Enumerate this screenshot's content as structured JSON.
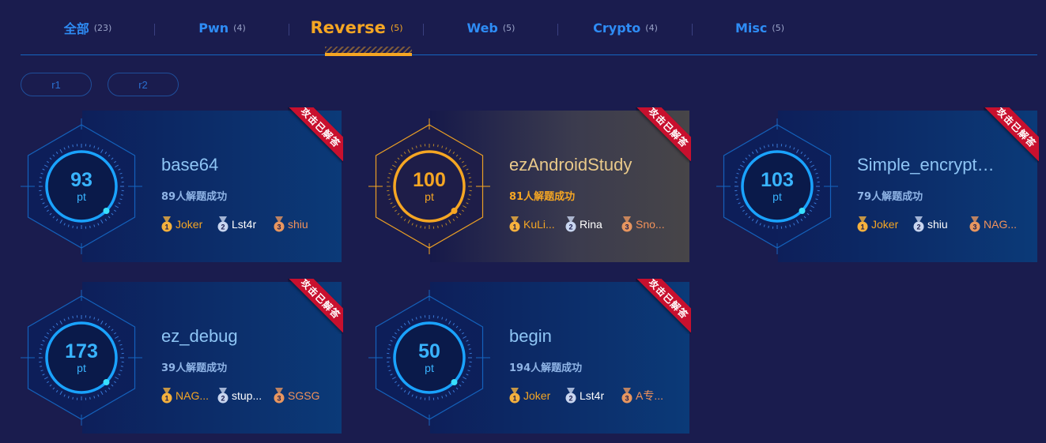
{
  "tabs": [
    {
      "label": "全部",
      "count": "(23)"
    },
    {
      "label": "Pwn",
      "count": "(4)"
    },
    {
      "label": "Reverse",
      "count": "(5)"
    },
    {
      "label": "Web",
      "count": "(5)"
    },
    {
      "label": "Crypto",
      "count": "(4)"
    },
    {
      "label": "Misc",
      "count": "(5)"
    }
  ],
  "active_tab": "Reverse",
  "filters": [
    "r1",
    "r2"
  ],
  "colors": {
    "accent": "#f5a623",
    "primary": "#2e8cf5",
    "ribbon": "#c8102e",
    "background": "#1a1c4e"
  },
  "ribbon_text": "攻击已解答",
  "cards": [
    {
      "score": "93",
      "unit": "pt",
      "name": "base64",
      "solved": "89人解题成功",
      "solvers": [
        {
          "rank": "1",
          "name": "Joker"
        },
        {
          "rank": "2",
          "name": "Lst4r"
        },
        {
          "rank": "3",
          "name": "shiu"
        }
      ]
    },
    {
      "score": "100",
      "unit": "pt",
      "name": "ezAndroidStudy",
      "solved": "81人解题成功",
      "highlighted": true,
      "solvers": [
        {
          "rank": "1",
          "name": "KuLi..."
        },
        {
          "rank": "2",
          "name": "Rina"
        },
        {
          "rank": "3",
          "name": "Sno..."
        }
      ]
    },
    {
      "score": "103",
      "unit": "pt",
      "name": "Simple_encrypt…",
      "solved": "79人解题成功",
      "solvers": [
        {
          "rank": "1",
          "name": "Joker"
        },
        {
          "rank": "2",
          "name": "shiu"
        },
        {
          "rank": "3",
          "name": "NAG..."
        }
      ]
    },
    {
      "score": "173",
      "unit": "pt",
      "name": "ez_debug",
      "solved": "39人解题成功",
      "solvers": [
        {
          "rank": "1",
          "name": "NAG..."
        },
        {
          "rank": "2",
          "name": "stup..."
        },
        {
          "rank": "3",
          "name": "SGSG"
        }
      ]
    },
    {
      "score": "50",
      "unit": "pt",
      "name": "begin",
      "solved": "194人解题成功",
      "solvers": [
        {
          "rank": "1",
          "name": "Joker"
        },
        {
          "rank": "2",
          "name": "Lst4r"
        },
        {
          "rank": "3",
          "name": "A专..."
        }
      ]
    }
  ]
}
